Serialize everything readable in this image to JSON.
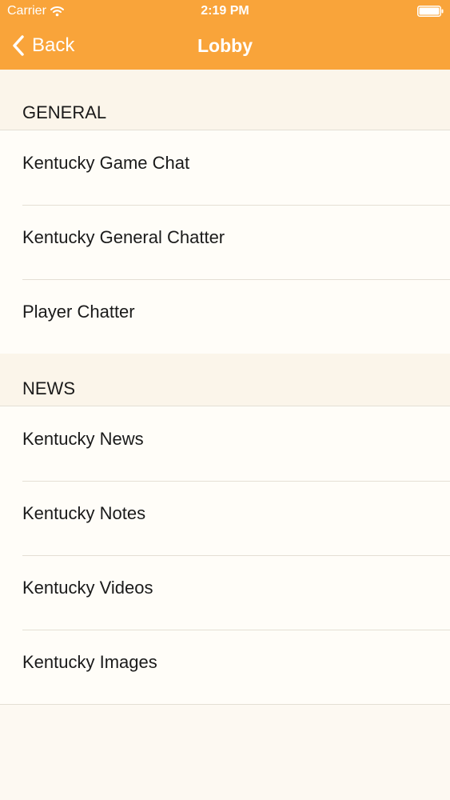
{
  "status_bar": {
    "carrier": "Carrier",
    "time": "2:19 PM"
  },
  "nav": {
    "back_label": "Back",
    "title": "Lobby"
  },
  "sections": [
    {
      "header": "GENERAL",
      "items": [
        {
          "label": "Kentucky Game Chat"
        },
        {
          "label": "Kentucky General Chatter"
        },
        {
          "label": "Player Chatter"
        }
      ]
    },
    {
      "header": "NEWS",
      "items": [
        {
          "label": "Kentucky News"
        },
        {
          "label": "Kentucky Notes"
        },
        {
          "label": "Kentucky Videos"
        },
        {
          "label": "Kentucky Images"
        }
      ]
    }
  ],
  "colors": {
    "nav_background": "#f9a43a",
    "page_background": "#fdf9f2",
    "separator": "#e4dfd5"
  },
  "icons": [
    "wifi-icon",
    "battery-icon",
    "back-chevron-icon"
  ]
}
